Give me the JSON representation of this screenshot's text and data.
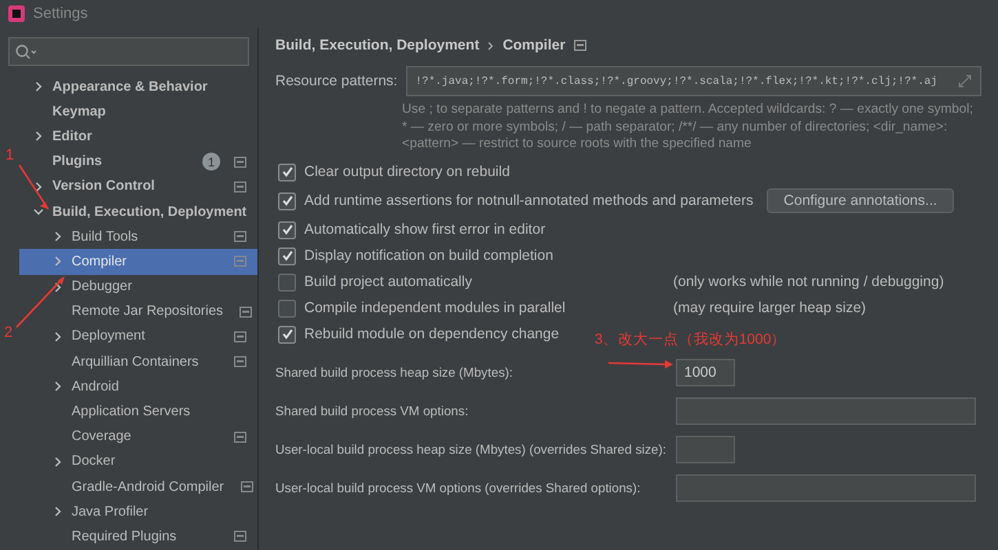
{
  "window": {
    "title": "Settings"
  },
  "sidebar": {
    "items": [
      {
        "label": "Appearance & Behavior",
        "expanded": false
      },
      {
        "label": "Keymap"
      },
      {
        "label": "Editor",
        "expanded": false
      },
      {
        "label": "Plugins",
        "badge": "1",
        "project_scope": true
      },
      {
        "label": "Version Control",
        "expanded": false,
        "project_scope": true
      },
      {
        "label": "Build, Execution, Deployment",
        "expanded": true,
        "children": [
          {
            "label": "Build Tools",
            "expanded": false,
            "project_scope": true,
            "selected": false
          },
          {
            "label": "Compiler",
            "expanded": false,
            "project_scope": true,
            "selected": true
          },
          {
            "label": "Debugger",
            "expanded": false,
            "selected": false
          },
          {
            "label": "Remote Jar Repositories",
            "project_scope": true,
            "selected": false
          },
          {
            "label": "Deployment",
            "expanded": false,
            "project_scope": true,
            "selected": false
          },
          {
            "label": "Arquillian Containers",
            "project_scope": true,
            "selected": false
          },
          {
            "label": "Android",
            "expanded": false,
            "selected": false
          },
          {
            "label": "Application Servers",
            "selected": false
          },
          {
            "label": "Coverage",
            "project_scope": true,
            "selected": false
          },
          {
            "label": "Docker",
            "expanded": false,
            "selected": false
          },
          {
            "label": "Gradle-Android Compiler",
            "project_scope": true,
            "selected": false
          },
          {
            "label": "Java Profiler",
            "expanded": false,
            "selected": false
          },
          {
            "label": "Required Plugins",
            "project_scope": true,
            "selected": false
          }
        ]
      }
    ]
  },
  "breadcrumb": [
    "Build, Execution, Deployment",
    "Compiler"
  ],
  "resource_patterns": {
    "label": "Resource patterns:",
    "value": "!?*.java;!?*.form;!?*.class;!?*.groovy;!?*.scala;!?*.flex;!?*.kt;!?*.clj;!?*.aj",
    "hint": "Use ; to separate patterns and ! to negate a pattern. Accepted wildcards: ? — exactly one symbol; * — zero or more symbols; / — path separator; /**/ — any number of directories; <dir_name>: <pattern> — restrict to source roots with the specified name"
  },
  "options": [
    {
      "label": "Clear output directory on rebuild",
      "checked": true
    },
    {
      "label": "Add runtime assertions for notnull-annotated methods and parameters",
      "checked": true,
      "button": "Configure annotations..."
    },
    {
      "label": "Automatically show first error in editor",
      "checked": true
    },
    {
      "label": "Display notification on build completion",
      "checked": true
    },
    {
      "label": "Build project automatically",
      "checked": false,
      "note": "(only works while not running / debugging)"
    },
    {
      "label": "Compile independent modules in parallel",
      "checked": false,
      "note": "(may require larger heap size)"
    },
    {
      "label": "Rebuild module on dependency change",
      "checked": true
    }
  ],
  "fields": [
    {
      "label": "Shared build process heap size (Mbytes):",
      "value": "1000",
      "kind": "short"
    },
    {
      "label": "Shared build process VM options:",
      "kind": "wide"
    },
    {
      "label": "User-local build process heap size (Mbytes) (overrides Shared size):",
      "kind": "short"
    },
    {
      "label": "User-local build process VM options (overrides Shared options):",
      "kind": "wide"
    }
  ],
  "annotations": [
    {
      "text": "1"
    },
    {
      "text": "2"
    },
    {
      "text": "3、改大一点（我改为1000）"
    }
  ]
}
